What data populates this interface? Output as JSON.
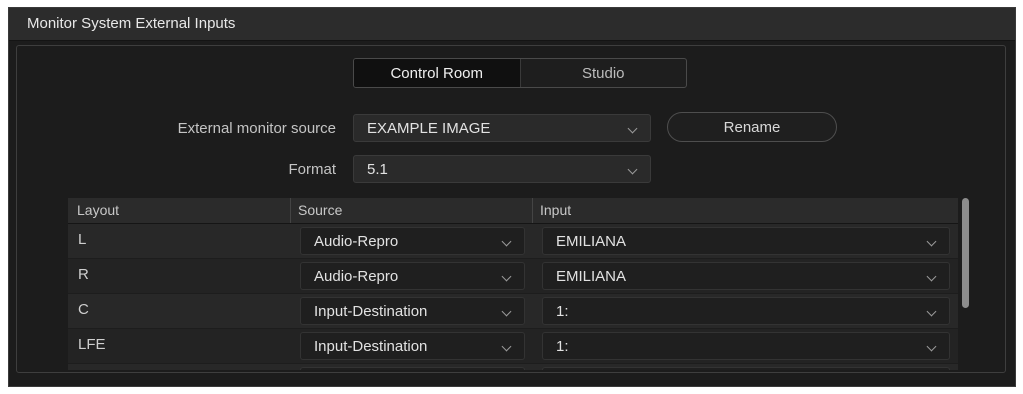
{
  "window": {
    "title": "Monitor System External Inputs"
  },
  "tabs": [
    {
      "label": "Control Room",
      "active": true
    },
    {
      "label": "Studio",
      "active": false
    }
  ],
  "external_source": {
    "label": "External monitor source",
    "value": "EXAMPLE IMAGE"
  },
  "rename_button": {
    "label": "Rename"
  },
  "format": {
    "label": "Format",
    "value": "5.1"
  },
  "table": {
    "headers": [
      "Layout",
      "Source",
      "Input"
    ],
    "rows": [
      {
        "layout": "L",
        "source": "Audio-Repro",
        "input": "EMILIANA"
      },
      {
        "layout": "R",
        "source": "Audio-Repro",
        "input": "EMILIANA"
      },
      {
        "layout": "C",
        "source": "Input-Destination",
        "input": "1:"
      },
      {
        "layout": "LFE",
        "source": "Input-Destination",
        "input": "1:"
      },
      {
        "layout": "",
        "source": "",
        "input": ""
      }
    ]
  },
  "colors": {
    "background": "#1c1c1c",
    "titlebar": "#2c2c2c",
    "accent": "#e8e8e8"
  }
}
